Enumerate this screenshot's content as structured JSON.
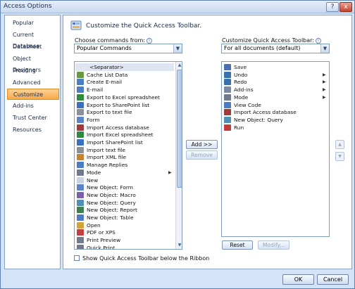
{
  "window": {
    "title": "Access Options",
    "help_glyph": "?",
    "close_glyph": "x"
  },
  "nav": {
    "items": [
      {
        "label": "Popular"
      },
      {
        "label": "Current Database"
      },
      {
        "label": "Datasheet"
      },
      {
        "label": "Object Designers"
      },
      {
        "label": "Proofing"
      },
      {
        "label": "Advanced"
      },
      {
        "label": "Customize",
        "selected": true
      },
      {
        "label": "Add-ins"
      },
      {
        "label": "Trust Center"
      },
      {
        "label": "Resources"
      }
    ]
  },
  "header": {
    "text": "Customize the Quick Access Toolbar."
  },
  "left_panel": {
    "label": "Choose commands from:",
    "combo_value": "Popular Commands",
    "items": [
      {
        "label": "<Separator>",
        "icon": "separator",
        "color": "#dfe6f2"
      },
      {
        "label": "Cache List Data",
        "icon": "cache-icon",
        "color": "#6a9a3f"
      },
      {
        "label": "Create E-mail",
        "icon": "email-create-icon",
        "color": "#4b7cc4"
      },
      {
        "label": "E-mail",
        "icon": "email-icon",
        "color": "#4b7cc4"
      },
      {
        "label": "Export to Excel spreadsheet",
        "icon": "excel-icon",
        "color": "#2e8a3c"
      },
      {
        "label": "Export to SharePoint list",
        "icon": "sharepoint-icon",
        "color": "#3b6fbf"
      },
      {
        "label": "Export to text file",
        "icon": "text-file-icon",
        "color": "#8a8f99"
      },
      {
        "label": "Form",
        "icon": "form-icon",
        "color": "#5b84c9"
      },
      {
        "label": "Import Access database",
        "icon": "access-icon",
        "color": "#a23a3a"
      },
      {
        "label": "Import Excel spreadsheet",
        "icon": "excel-icon",
        "color": "#2e8a3c"
      },
      {
        "label": "Import SharePoint list",
        "icon": "sharepoint-icon",
        "color": "#3b6fbf"
      },
      {
        "label": "Import text file",
        "icon": "text-file-icon",
        "color": "#8a8f99"
      },
      {
        "label": "Import XML file",
        "icon": "xml-icon",
        "color": "#c7832c"
      },
      {
        "label": "Manage Replies",
        "icon": "replies-icon",
        "color": "#4b7cc4"
      },
      {
        "label": "Mode",
        "icon": "mode-icon",
        "color": "#6f7a8c",
        "submenu": true
      },
      {
        "label": "New",
        "icon": "new-icon",
        "color": "#c9d2e0"
      },
      {
        "label": "New Object: Form",
        "icon": "form-icon",
        "color": "#5b84c9"
      },
      {
        "label": "New Object: Macro",
        "icon": "macro-icon",
        "color": "#7b5fa8"
      },
      {
        "label": "New Object: Query",
        "icon": "query-icon",
        "color": "#4f8fb3"
      },
      {
        "label": "New Object: Report",
        "icon": "report-icon",
        "color": "#3f7f4f"
      },
      {
        "label": "New Object: Table",
        "icon": "table-icon",
        "color": "#4b7cc4"
      },
      {
        "label": "Open",
        "icon": "folder-icon",
        "color": "#d4a43a"
      },
      {
        "label": "PDF or XPS",
        "icon": "pdf-icon",
        "color": "#c44040"
      },
      {
        "label": "Print Preview",
        "icon": "print-preview-icon",
        "color": "#6f7a8c"
      },
      {
        "label": "Quick Print",
        "icon": "print-icon",
        "color": "#6f7a8c"
      }
    ]
  },
  "right_panel": {
    "label": "Customize Quick Access Toolbar:",
    "combo_value": "For all documents (default)",
    "items": [
      {
        "label": "Save",
        "icon": "save-icon",
        "color": "#4b6fb3"
      },
      {
        "label": "Undo",
        "icon": "undo-icon",
        "color": "#3a6fb0",
        "submenu": true
      },
      {
        "label": "Redo",
        "icon": "redo-icon",
        "color": "#3a6fb0",
        "submenu": true
      },
      {
        "label": "Add-ins",
        "icon": "addins-icon",
        "color": "#7a8aa5",
        "submenu": true
      },
      {
        "label": "Mode",
        "icon": "mode-icon",
        "color": "#6f7a8c",
        "submenu": true
      },
      {
        "label": "View Code",
        "icon": "code-icon",
        "color": "#4b7cc4"
      },
      {
        "label": "Import Access database",
        "icon": "access-icon",
        "color": "#a23a3a"
      },
      {
        "label": "New Object: Query",
        "icon": "query-icon",
        "color": "#4f8fb3"
      },
      {
        "label": "Run",
        "icon": "run-icon",
        "color": "#c33b3b"
      }
    ]
  },
  "buttons": {
    "add": "Add >>",
    "remove": "Remove",
    "reset": "Reset",
    "modify": "Modify...",
    "ok": "OK",
    "cancel": "Cancel",
    "move_up": "▲",
    "move_down": "▼"
  },
  "checkbox": {
    "label": "Show Quick Access Toolbar below the Ribbon",
    "checked": false
  },
  "glyphs": {
    "combo_arrow": "▼",
    "scroll_up": "▲",
    "scroll_down": "▼",
    "submenu": "▶",
    "info": "i"
  }
}
